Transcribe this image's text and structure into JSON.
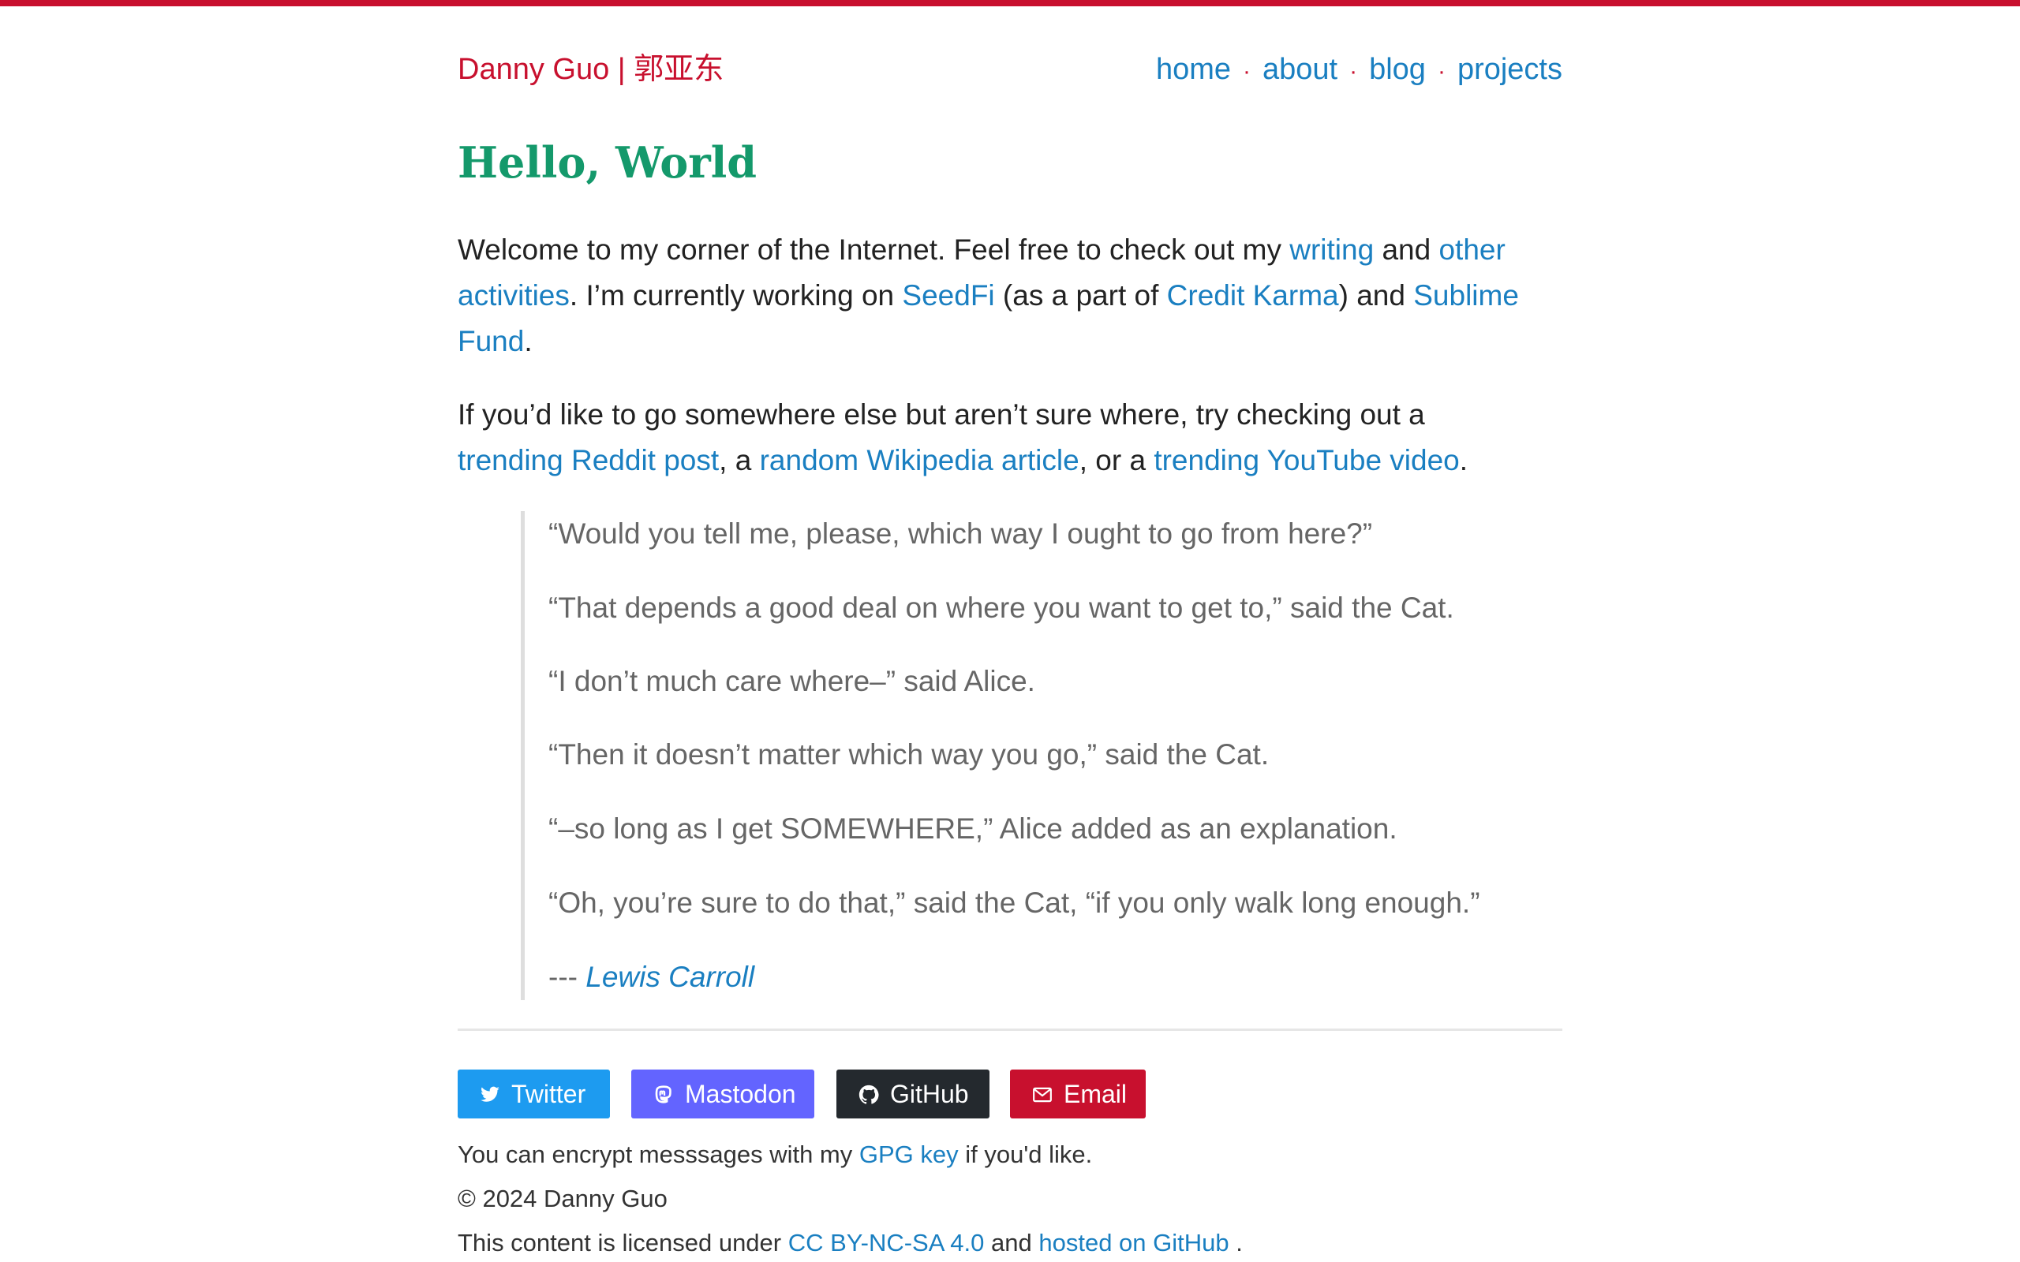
{
  "colors": {
    "accent": "#c8102e",
    "link": "#1a7fc1",
    "title": "#14996b",
    "twitter": "#1d9bf0",
    "mastodon": "#6364ff",
    "github": "#24292e",
    "email": "#c8102e"
  },
  "header": {
    "site_title": "Danny Guo | 郭亚东",
    "nav": [
      {
        "label": "home"
      },
      {
        "label": "about"
      },
      {
        "label": "blog"
      },
      {
        "label": "projects"
      }
    ],
    "separator": "·"
  },
  "main": {
    "title": "Hello, World",
    "intro": {
      "t1": "Welcome to my corner of the Internet. Feel free to check out my ",
      "writing_link": "writing",
      "t2": " and ",
      "other_link_a": "other",
      "other_link_b": "activities",
      "t3": ". I’m currently working on ",
      "seedfi_link": "SeedFi",
      "t4": " (as a part of ",
      "creditkarma_link": "Credit Karma",
      "t5": ") and ",
      "sublime_link_a": "Sublime",
      "sublime_link_b": "Fund",
      "t6": "."
    },
    "suggest": {
      "t1": "If you’d like to go somewhere else but aren’t sure where, try checking out a",
      "reddit_link": "trending Reddit post",
      "t2": ", a ",
      "wikipedia_link": "random Wikipedia article",
      "t3": ", or a ",
      "youtube_link": "trending YouTube video",
      "t4": "."
    },
    "quote": {
      "lines": [
        "“Would you tell me, please, which way I ought to go from here?”",
        "“That depends a good deal on where you want to get to,” said the Cat.",
        "“I don’t much care where–” said Alice.",
        "“Then it doesn’t matter which way you go,” said the Cat.",
        "“–so long as I get SOMEWHERE,” Alice added as an explanation.",
        "“Oh, you’re sure to do that,” said the Cat, “if you only walk long enough.”"
      ],
      "attribution_prefix": "--- ",
      "author": "Lewis Carroll"
    }
  },
  "footer": {
    "buttons": {
      "twitter": {
        "label": "Twitter",
        "icon": "twitter-icon"
      },
      "mastodon": {
        "label": "Mastodon",
        "icon": "mastodon-icon"
      },
      "github": {
        "label": "GitHub",
        "icon": "github-icon"
      },
      "email": {
        "label": "Email",
        "icon": "envelope-icon"
      }
    },
    "gpg": {
      "t1": "You can encrypt messsages with my ",
      "link": "GPG key",
      "t2": " if you'd like."
    },
    "copyright": "© 2024 Danny Guo",
    "license": {
      "t1": "This content is licensed under ",
      "license_link": "CC BY-NC-SA 4.0",
      "t2": " and ",
      "hosted_link": "hosted on GitHub",
      "t3": " ."
    }
  }
}
